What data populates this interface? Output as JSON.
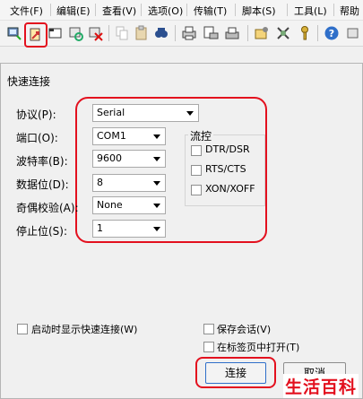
{
  "menu": [
    "文件(F)",
    "编辑(E)",
    "查看(V)",
    "选项(O)",
    "传输(T)",
    "脚本(S)",
    "工具(L)",
    "帮助"
  ],
  "toolbar": {
    "icons": [
      "connect-icon",
      "quick-connect-icon",
      "connect-tab-icon",
      "reconnect-icon",
      "disconnect-icon",
      "copy-icon",
      "paste-icon",
      "find-icon",
      "print-icon",
      "print-setup-icon",
      "print-icon-2",
      "session-options-icon",
      "keymap-icon",
      "key-icon",
      "help-icon"
    ],
    "highlighted": "quick-connect-icon"
  },
  "dialog": {
    "title": "快速连接",
    "protocol": {
      "label": "协议(P):",
      "value": "Serial"
    },
    "port": {
      "label": "端口(O):",
      "value": "COM1"
    },
    "baud": {
      "label": "波特率(B):",
      "value": "9600"
    },
    "databits": {
      "label": "数据位(D):",
      "value": "8"
    },
    "parity": {
      "label": "奇偶校验(A):",
      "value": "None"
    },
    "stopbits": {
      "label": "停止位(S):",
      "value": "1"
    },
    "flow": {
      "title": "流控",
      "dtr": "DTR/DSR",
      "rts": "RTS/CTS",
      "xon": "XON/XOFF"
    },
    "show_on_startup": "启动时显示快速连接(W)",
    "save_session": "保存会话(V)",
    "open_in_tab": "在标签页中打开(T)",
    "connect_button": "连接",
    "cancel_button": "取消"
  },
  "watermark": "生活百科",
  "colors": {
    "highlight": "#e3101e"
  }
}
